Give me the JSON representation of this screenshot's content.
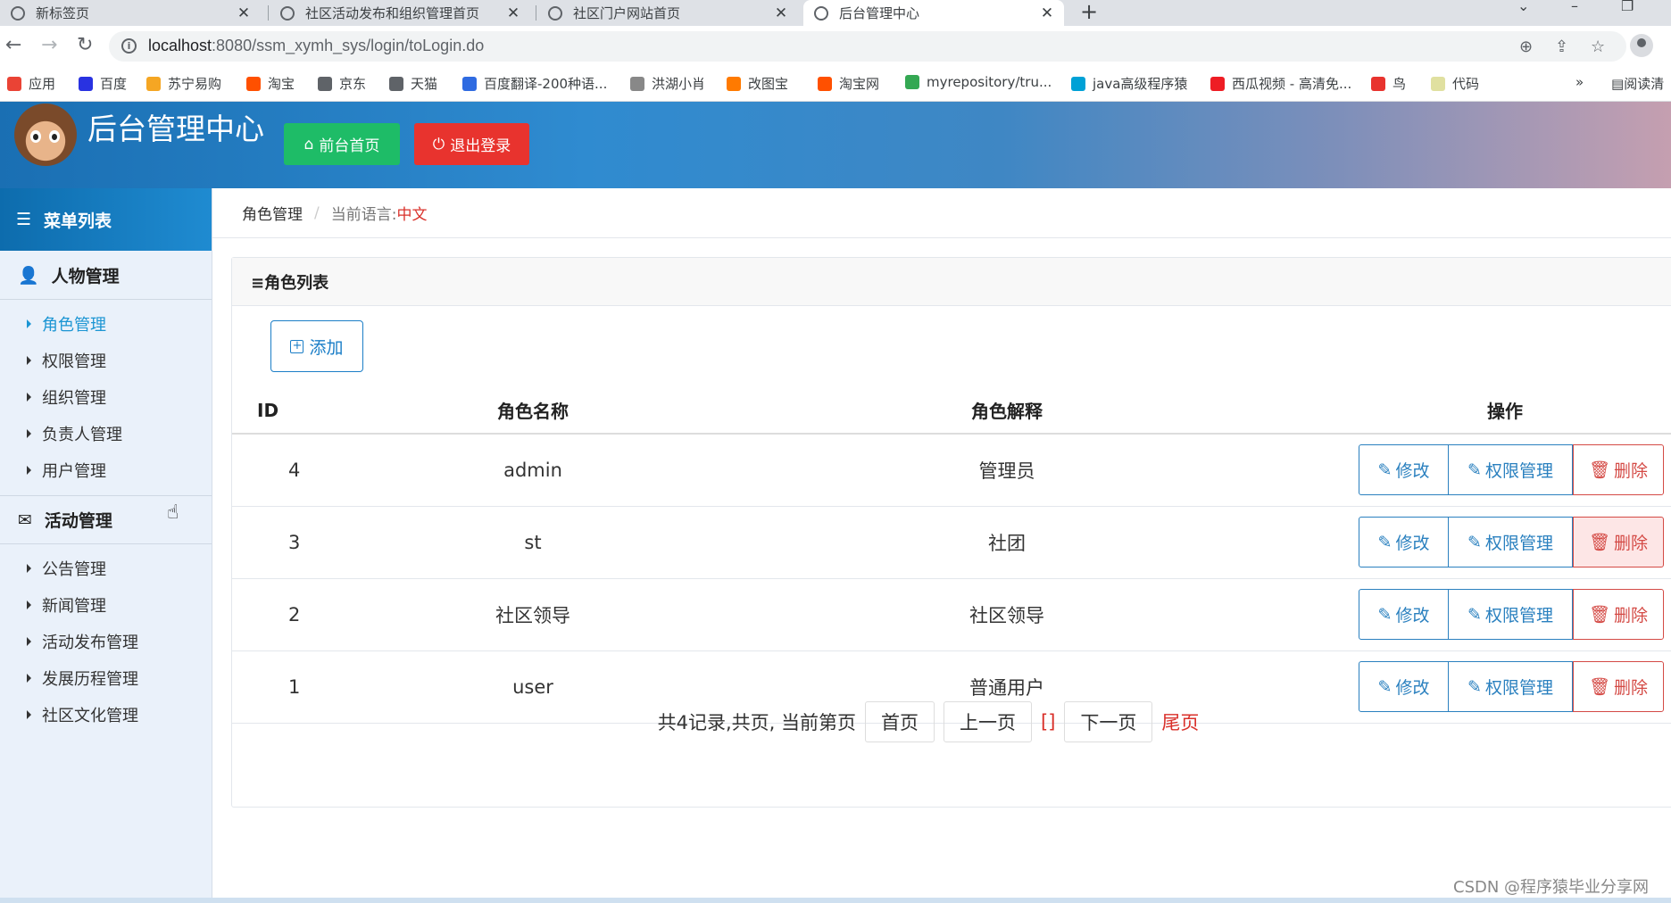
{
  "browser": {
    "tabs": [
      {
        "label": "新标签页",
        "active": false
      },
      {
        "label": "社区活动发布和组织管理首页",
        "active": false
      },
      {
        "label": "社区门户网站首页",
        "active": false
      },
      {
        "label": "后台管理中心",
        "active": true
      }
    ],
    "new_tab": "+",
    "url_host": "localhost",
    "url_rest": ":8080/ssm_xymh_sys/login/toLogin.do",
    "bookmarks": [
      {
        "label": "应用",
        "color": "#ea4335"
      },
      {
        "label": "百度",
        "color": "#2932e1"
      },
      {
        "label": "苏宁易购",
        "color": "#f5a623"
      },
      {
        "label": "淘宝",
        "color": "#ff5000"
      },
      {
        "label": "京东",
        "color": "#5f6368"
      },
      {
        "label": "天猫",
        "color": "#5f6368"
      },
      {
        "label": "百度翻译-200种语...",
        "color": "#2f6be1"
      },
      {
        "label": "洪湖小肖",
        "color": "#888888"
      },
      {
        "label": "改图宝",
        "color": "#ff7a00"
      },
      {
        "label": "淘宝网",
        "color": "#ff5000"
      },
      {
        "label": "myrepository/tru...",
        "color": "#34a853"
      },
      {
        "label": "java高级程序猿",
        "color": "#00a1d6"
      },
      {
        "label": "西瓜视频 - 高清免...",
        "color": "#ee1d24"
      },
      {
        "label": "鸟",
        "color": "#e8332e"
      },
      {
        "label": "代码",
        "color": "#e0e0a0"
      }
    ],
    "more": "»",
    "reading_list": "阅读清"
  },
  "header": {
    "title": "后台管理中心",
    "home_button": "前台首页",
    "logout_button": "退出登录"
  },
  "sidebar": {
    "title": "菜单列表",
    "groups": [
      {
        "label": "人物管理",
        "items": [
          "角色管理",
          "权限管理",
          "组织管理",
          "负责人管理",
          "用户管理"
        ]
      },
      {
        "label": "活动管理",
        "items": [
          "公告管理",
          "新闻管理",
          "活动发布管理",
          "发展历程管理",
          "社区文化管理"
        ]
      }
    ]
  },
  "breadcrumb": {
    "current": "角色管理",
    "separator": "/",
    "lang_label": "当前语言:",
    "lang_value": "中文"
  },
  "panel": {
    "title": "≡角色列表",
    "add_button": "添加",
    "columns": [
      "ID",
      "角色名称",
      "角色解释",
      "操作"
    ],
    "rows": [
      {
        "id": "4",
        "name": "admin",
        "desc": "管理员"
      },
      {
        "id": "3",
        "name": "st",
        "desc": "社团"
      },
      {
        "id": "2",
        "name": "社区领导",
        "desc": "社区领导"
      },
      {
        "id": "1",
        "name": "user",
        "desc": "普通用户"
      }
    ],
    "actions": {
      "edit": "修改",
      "perm": "权限管理",
      "delete": "删除"
    }
  },
  "pager": {
    "summary": "共4记录,共页, 当前第页",
    "first": "首页",
    "prev": "上一页",
    "current": "[]",
    "next": "下一页",
    "last": "尾页"
  },
  "watermark": "CSDN @程序猿毕业分享网"
}
